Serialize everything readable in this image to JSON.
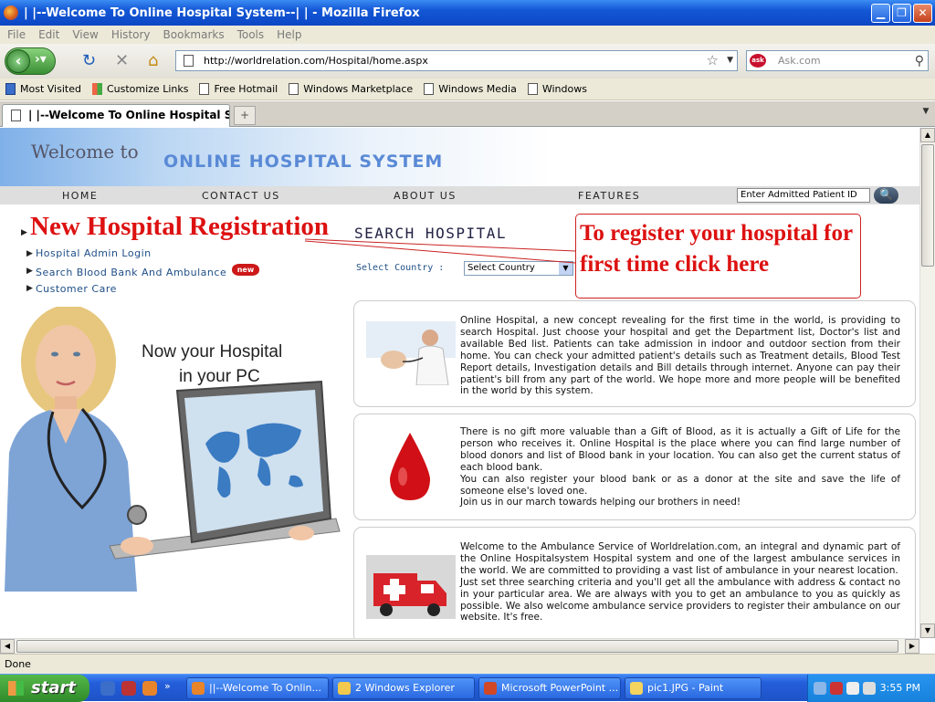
{
  "window": {
    "title": "| |--Welcome To Online Hospital System--| | - Mozilla Firefox"
  },
  "menu": [
    "File",
    "Edit",
    "View",
    "History",
    "Bookmarks",
    "Tools",
    "Help"
  ],
  "toolbar": {
    "url": "http://worldrelation.com/Hospital/home.aspx",
    "search_placeholder": "Ask.com"
  },
  "bookmarks": [
    "Most Visited",
    "Customize Links",
    "Free Hotmail",
    "Windows Marketplace",
    "Windows Media",
    "Windows"
  ],
  "tab": {
    "label": "| |--Welcome To Online Hospital Sys...",
    "new_tab": "+"
  },
  "page": {
    "welcome": "Welcome to",
    "brand": "ONLINE HOSPITAL SYSTEM",
    "nav": [
      "HOME",
      "CONTACT US",
      "ABOUT US",
      "FEATURES"
    ],
    "patient_id_placeholder": "Enter Admitted Patient ID",
    "registration": "New Hospital Registration",
    "links": [
      "Hospital Admin Login",
      "Search Blood Bank And Ambulance",
      "Customer Care"
    ],
    "new_badge": "new",
    "search_hospital": "SEARCH HOSPITAL",
    "select_country_label": "Select Country  :",
    "select_country_value": "Select Country",
    "callout": "To register your hospital for first time click here",
    "hero_text_1": "Now your Hospital",
    "hero_text_2": "in your PC",
    "cards": [
      "   Online Hospital, a new concept revealing for the first time in the world, is providing to search Hospital. Just choose your hospital and get the Department list, Doctor's list and available Bed list. Patients can take admission in indoor and outdoor section from their home. You can check your admitted patient's details such as Treatment details, Blood Test Report details, Investigation details and Bill details through internet. Anyone can pay their patient's bill from any part of the world. We hope more and more people will be benefited in the world by this system.",
      "   There is no gift more valuable than a Gift of Blood, as it is actually a Gift of Life for the person who receives it. Online Hospital is the place where you can find large number of blood donors and list of Blood bank in your location. You can also get the current status of each blood bank.\n   You can also register your blood bank or as a donor at the site and save the life of someone else's loved one.\nJoin us in our march towards helping our brothers in need!",
      "   Welcome to the Ambulance Service of Worldrelation.com, an integral and dynamic part of the Online Hospitalsystem Hospital system and one of the largest ambulance services in the world. We are committed to providing a vast list of ambulance in your nearest location.\n   Just set three searching criteria and you'll get all the ambulance with address & contact no in your particular area. We are always with you to get an ambulance to you as quickly as possible. We also welcome ambulance service providers to register their ambulance on our website. It's free."
    ]
  },
  "status": {
    "text": "Done"
  },
  "taskbar": {
    "start": "start",
    "items": [
      "||--Welcome To Onlin...",
      "2 Windows Explorer",
      "Microsoft PowerPoint ...",
      "pic1.JPG - Paint"
    ],
    "clock": "3:55 PM"
  },
  "colors": {
    "accent_red": "#dd1111",
    "brand_blue": "#5a8ad6",
    "link_blue": "#1f4f87"
  }
}
